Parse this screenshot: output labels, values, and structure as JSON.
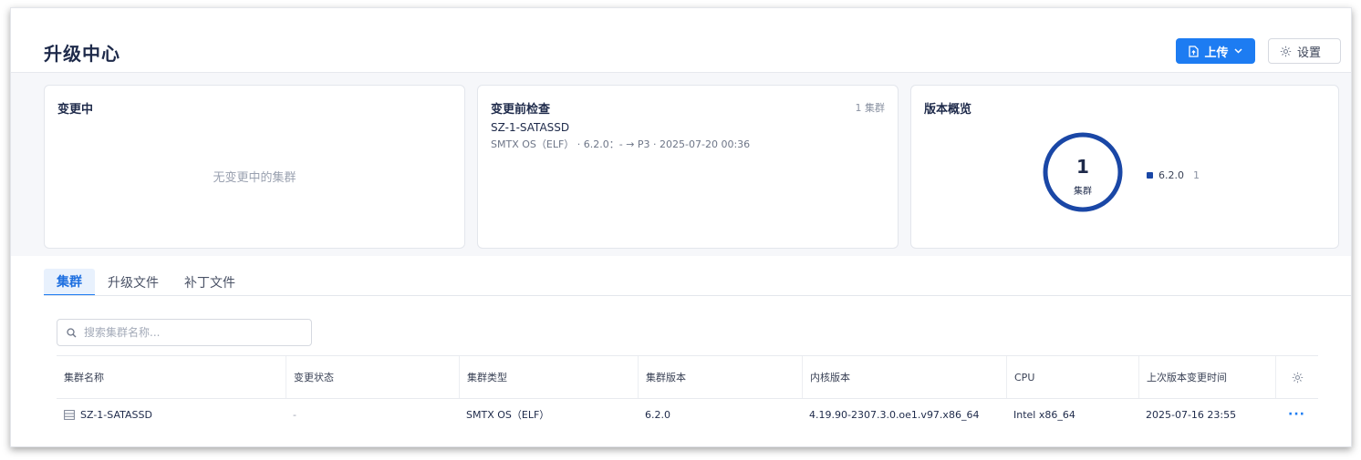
{
  "header": {
    "title": "升级中心",
    "upload_label": "上传",
    "settings_label": "设置"
  },
  "cards": {
    "changing": {
      "title": "变更中",
      "empty": "无变更中的集群"
    },
    "precheck": {
      "title": "变更前检查",
      "count": "1 集群",
      "cluster_name": "SZ-1-SATASSD",
      "detail": "SMTX OS（ELF） · 6.2.0：- → P3 · 2025-07-20 00:36"
    },
    "overview": {
      "title": "版本概览",
      "total": "1",
      "total_label": "集群",
      "legend": [
        {
          "version": "6.2.0",
          "count": "1",
          "color": "#1a47a6"
        }
      ]
    }
  },
  "tabs": [
    {
      "label": "集群",
      "active": true
    },
    {
      "label": "升级文件",
      "active": false
    },
    {
      "label": "补丁文件",
      "active": false
    }
  ],
  "search": {
    "placeholder": "搜索集群名称...",
    "value": ""
  },
  "table": {
    "columns": [
      "集群名称",
      "变更状态",
      "集群类型",
      "集群版本",
      "内核版本",
      "CPU",
      "上次版本变更时间"
    ],
    "rows": [
      {
        "name": "SZ-1-SATASSD",
        "status": "-",
        "type": "SMTX OS（ELF）",
        "version": "6.2.0",
        "kernel": "4.19.90-2307.3.0.oe1.v97.x86_64",
        "cpu": "Intel x86_64",
        "last_change": "2025-07-16 23:55",
        "more": "···"
      }
    ]
  },
  "colors": {
    "accent": "#1d7cf2",
    "donut": "#1a47a6"
  },
  "icons": [
    "upload-file-icon",
    "chevron-down-icon",
    "gear-icon",
    "search-icon",
    "cluster-icon",
    "more-icon"
  ]
}
